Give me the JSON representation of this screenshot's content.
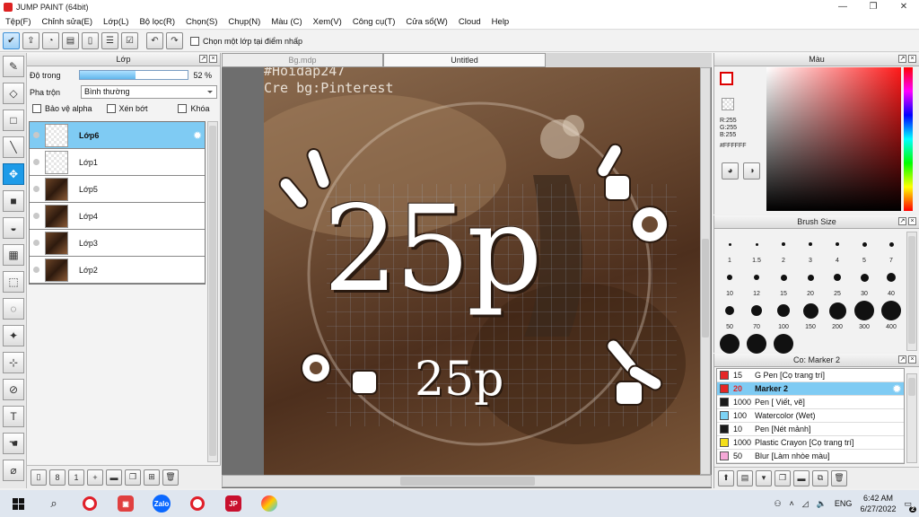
{
  "window": {
    "title": "JUMP PAINT (64bit)",
    "minimize": "—",
    "restore": "❐",
    "close": "✕"
  },
  "menu": [
    "Tệp(F)",
    "Chỉnh sửa(E)",
    "Lớp(L)",
    "Bộ lọc(R)",
    "Chọn(S)",
    "Chụp(N)",
    "Màu (C)",
    "Xem(V)",
    "Công cụ(T)",
    "Cửa sổ(W)",
    "Cloud",
    "Help"
  ],
  "toolbar": {
    "pick_layer_label": "Chọn một lớp tại điểm nhấp"
  },
  "layer_panel": {
    "title": "Lớp",
    "opacity_label": "Độ trong",
    "opacity_value": "52 %",
    "opacity_fraction": 0.52,
    "blend_label": "Pha trộn",
    "blend_value": "Bình thường",
    "protect_alpha": "Bảo vệ alpha",
    "clipping": "Xén bớt",
    "lock": "Khóa",
    "layers": [
      {
        "name": "Lớp6",
        "selected": true,
        "thumb": "trans"
      },
      {
        "name": "Lớp1",
        "selected": false,
        "thumb": "trans"
      },
      {
        "name": "Lớp5",
        "selected": false,
        "thumb": "photo"
      },
      {
        "name": "Lớp4",
        "selected": false,
        "thumb": "photo"
      },
      {
        "name": "Lớp3",
        "selected": false,
        "thumb": "photo"
      },
      {
        "name": "Lớp2",
        "selected": false,
        "thumb": "photo"
      }
    ]
  },
  "documents": {
    "tabs": [
      "Bg.mdp",
      "Untitled"
    ],
    "active": "Untitled"
  },
  "canvas": {
    "watermark1": "#Hoidap247",
    "watermark2": "Cre bg:Pinterest",
    "big_text": "25p",
    "small_text": "25p"
  },
  "color_panel": {
    "title": "Màu",
    "r": "R:255",
    "g": "G:255",
    "b": "B:255",
    "hex": "#FFFFFF"
  },
  "brush_panel": {
    "title": "Brush Size",
    "sizes": [
      "1",
      "1.5",
      "2",
      "3",
      "4",
      "5",
      "7",
      "10",
      "12",
      "15",
      "20",
      "25",
      "30",
      "40",
      "50",
      "70",
      "100",
      "150",
      "200",
      "300",
      "400",
      "",
      "",
      ""
    ]
  },
  "marker_panel": {
    "title": "Co: Marker 2",
    "items": [
      {
        "size": "15",
        "name": "G Pen [Cọ trang trí]",
        "color": "#e52626",
        "selected": false
      },
      {
        "size": "20",
        "name": "Marker 2",
        "color": "#e52626",
        "selected": true
      },
      {
        "size": "1000",
        "name": "Pen [ Viết, vẽ]",
        "color": "#1a1a1a",
        "selected": false
      },
      {
        "size": "100",
        "name": "Watercolor (Wet)",
        "color": "#7dd3f5",
        "selected": false
      },
      {
        "size": "10",
        "name": "Pen [Nét mảnh]",
        "color": "#1a1a1a",
        "selected": false
      },
      {
        "size": "1000",
        "name": "Plastic Crayon [Cọ trang trí]",
        "color": "#f5df1a",
        "selected": false
      },
      {
        "size": "50",
        "name": "Blur [Làm nhòe màu]",
        "color": "#f5a8d8",
        "selected": false
      }
    ]
  },
  "taskbar": {
    "lang": "ENG",
    "time": "6:42 AM",
    "date": "6/27/2022",
    "zalo": "Zalo",
    "notif": "2"
  }
}
